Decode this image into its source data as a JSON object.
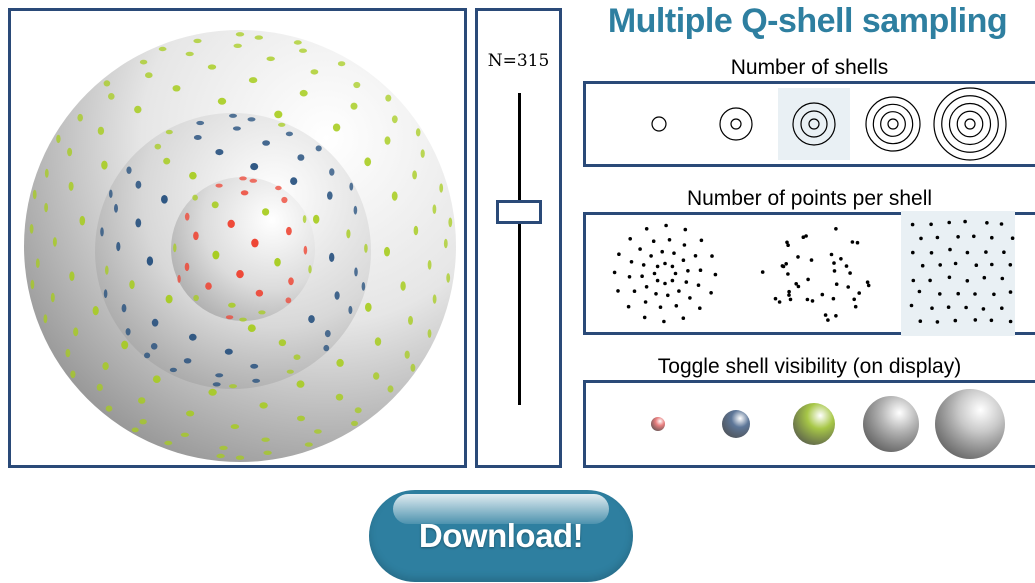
{
  "app": {
    "title": "Multiple Q-shell sampling",
    "accent_color": "#2e7fa0",
    "border_color": "#2a4a78"
  },
  "viewer": {
    "shell_colors": [
      "#ee4433",
      "#1e4a7a",
      "#a6cc1c",
      "#a6cc1c"
    ],
    "visible_shells": 3
  },
  "slider": {
    "label": "N=315",
    "value_fraction": 0.62
  },
  "shells_selector": {
    "label": "Number of shells",
    "options": [
      {
        "id": "shells-1",
        "rings": 1
      },
      {
        "id": "shells-2",
        "rings": 2
      },
      {
        "id": "shells-3",
        "rings": 3
      },
      {
        "id": "shells-4",
        "rings": 4
      },
      {
        "id": "shells-5",
        "rings": 5
      }
    ],
    "selected": 2
  },
  "points_selector": {
    "label": "Number of points per shell",
    "options": [
      "points-constant",
      "points-random",
      "points-proportional"
    ],
    "selected": 2
  },
  "toggle_selector": {
    "label": "Toggle shell visibility (on display)",
    "spheres": [
      {
        "id": "shell-1",
        "color": "#e98080"
      },
      {
        "id": "shell-2",
        "color": "#5e7799"
      },
      {
        "id": "shell-3",
        "color": "#a7c747"
      },
      {
        "id": "shell-4",
        "color": "#b8b8b8"
      },
      {
        "id": "shell-5",
        "color": "#c8c8c8"
      }
    ]
  },
  "download": {
    "label": "Download!"
  }
}
